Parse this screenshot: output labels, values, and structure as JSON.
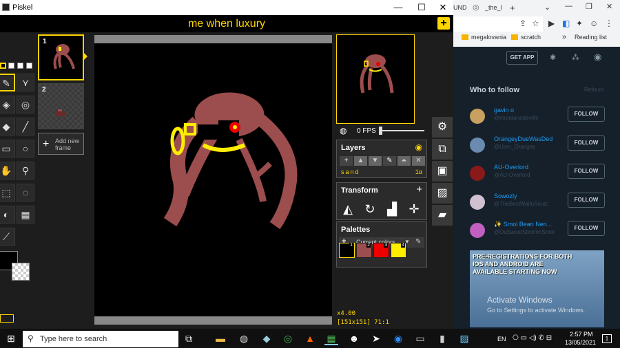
{
  "window": {
    "title": "Piskel",
    "minimize": "—",
    "maximize": "☐",
    "close": "✕"
  },
  "header": {
    "title": "me when luxury",
    "plus": "+"
  },
  "frames": [
    {
      "num": "1"
    },
    {
      "num": "2"
    }
  ],
  "add_frame": {
    "plus": "+",
    "label_line1": "Add new",
    "label_line2": "frame"
  },
  "status": {
    "zoom": "x4.00",
    "size": "[151x151] 71:1"
  },
  "fps": {
    "label": "0 FPS"
  },
  "layers": {
    "title": "Layers",
    "layer_name": "sand",
    "opacity": "1α"
  },
  "transform": {
    "title": "Transform",
    "plus": "+"
  },
  "palettes": {
    "title": "Palettes",
    "selected": "Current colors",
    "plus": "+",
    "swatches": [
      {
        "num": "1",
        "color": "#000000"
      },
      {
        "num": "2",
        "color": "#9c4d4d"
      },
      {
        "num": "3",
        "color": "#ee0000"
      },
      {
        "num": "4",
        "color": "#ffee00"
      }
    ]
  },
  "colors": {
    "primary": "#000000",
    "accent": "#ffd700"
  },
  "browser": {
    "tabs": [
      "UND",
      "_the_l"
    ],
    "tab_plus": "+",
    "bookmarks": [
      "megalovania",
      "scratch"
    ],
    "bookmark_more": "»",
    "reading_list": "Reading list",
    "get_app": "GET APP"
  },
  "twitter": {
    "who_to_follow": "Who to follow",
    "refresh": "Refresh",
    "follow_label": "FOLLOW",
    "suggestions": [
      {
        "name": "gavin o",
        "handle": "@mundanedevilfe"
      },
      {
        "name": "OrangeyDueWasDed",
        "handle": "@User_Orangey"
      },
      {
        "name": "AU-Overlord",
        "handle": "@AU-Overlord"
      },
      {
        "name": "Sowozly",
        "handle": "@TheBestWaifuSoulz"
      },
      {
        "name": "✨ Smol Bean Nen...",
        "handle": "@OuSweetStickmnSmol"
      }
    ],
    "ad_line1": "PRE-REGISTRATIONS FOR BOTH",
    "ad_line2": "IOS AND ANDROID ARE",
    "ad_line3": "AVAILABLE STARTING NOW"
  },
  "watermark": {
    "line1": "Activate Windows",
    "line2": "Go to Settings to activate Windows."
  },
  "taskbar": {
    "search_placeholder": "Type here to search",
    "lang": "EN",
    "time": "2:57 PM",
    "date": "13/05/2021",
    "notifications": "1"
  }
}
